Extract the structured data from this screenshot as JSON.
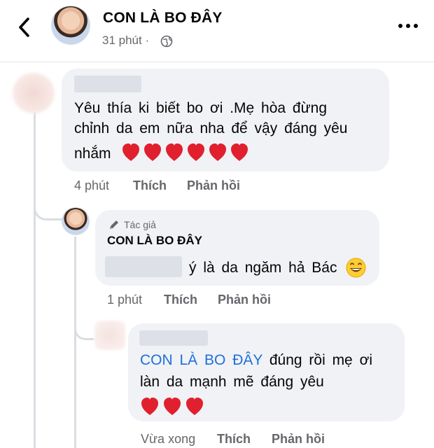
{
  "header": {
    "page_name": "CON LÀ BO ĐÂY",
    "time": "31 phút ·",
    "privacy_icon": "globe-icon",
    "back_icon": "back-chevron-icon",
    "more_icon": "more-horizontal-icon"
  },
  "comments": [
    {
      "text_lines": [
        "Yêu thía ki biết bo ơi .Mẹ hòa đừng",
        "chỉnh da em nữa nha để vậy đáng yêu",
        "nhắm"
      ],
      "emoji": "heart x6",
      "time": "4 phút",
      "like_label": "Thích",
      "reply_label": "Phản hồi"
    },
    {
      "badge": "Tác giả",
      "author": "CON LÀ BO ĐÂY",
      "text": "ý là da ngăm hả Bác",
      "emoji": "grinning-face",
      "time": "1 phút",
      "like_label": "Thích",
      "reply_label": "Phản hồi"
    },
    {
      "mention": "CON LÀ BO ĐÂY",
      "text_line1": "đúng rồi mẹ ơi",
      "text_line2": "làn da mạnh mẽ đáng yêu",
      "emoji": "heart x3",
      "time": "Vừa xong",
      "like_label": "Thích",
      "reply_label": "Phản hồi"
    }
  ],
  "colors": {
    "bubble": "#f0f2f5",
    "meta_text": "#65676b",
    "mention": "#216fdb",
    "heart": "#e0202e"
  }
}
